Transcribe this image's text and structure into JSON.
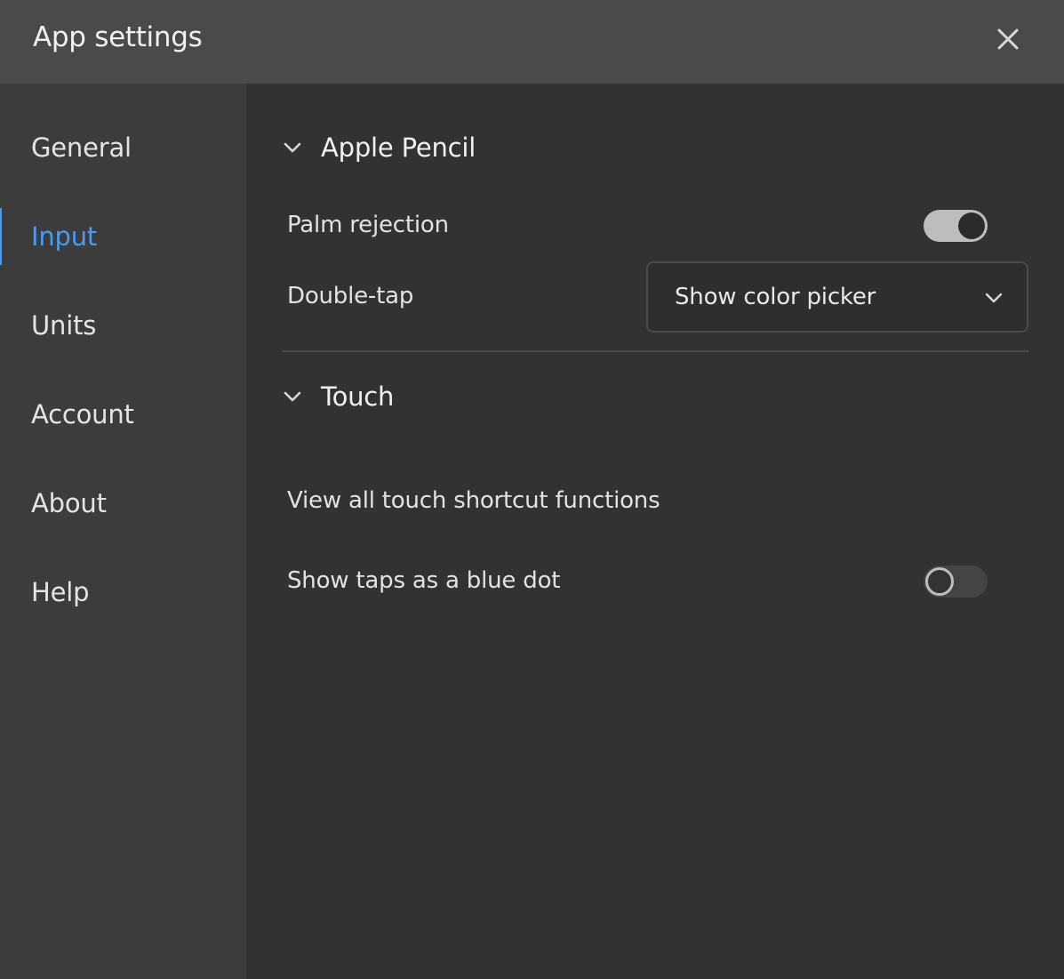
{
  "window": {
    "title": "App settings",
    "close_icon": "close-icon"
  },
  "sidebar": {
    "active_index": 1,
    "accent_color": "#4a9bf0",
    "items": [
      {
        "label": "General"
      },
      {
        "label": "Input"
      },
      {
        "label": "Units"
      },
      {
        "label": "Account"
      },
      {
        "label": "About"
      },
      {
        "label": "Help"
      }
    ]
  },
  "apple_pencil": {
    "title": "Apple Pencil",
    "expanded": true,
    "palm_rejection": {
      "label": "Palm rejection",
      "enabled": true
    },
    "double_tap": {
      "label": "Double-tap",
      "value": "Show color picker"
    }
  },
  "touch": {
    "title": "Touch",
    "expanded": true,
    "view_shortcuts": {
      "label": "View all touch shortcut functions"
    },
    "show_taps": {
      "label": "Show taps as a blue dot",
      "enabled": false
    }
  }
}
